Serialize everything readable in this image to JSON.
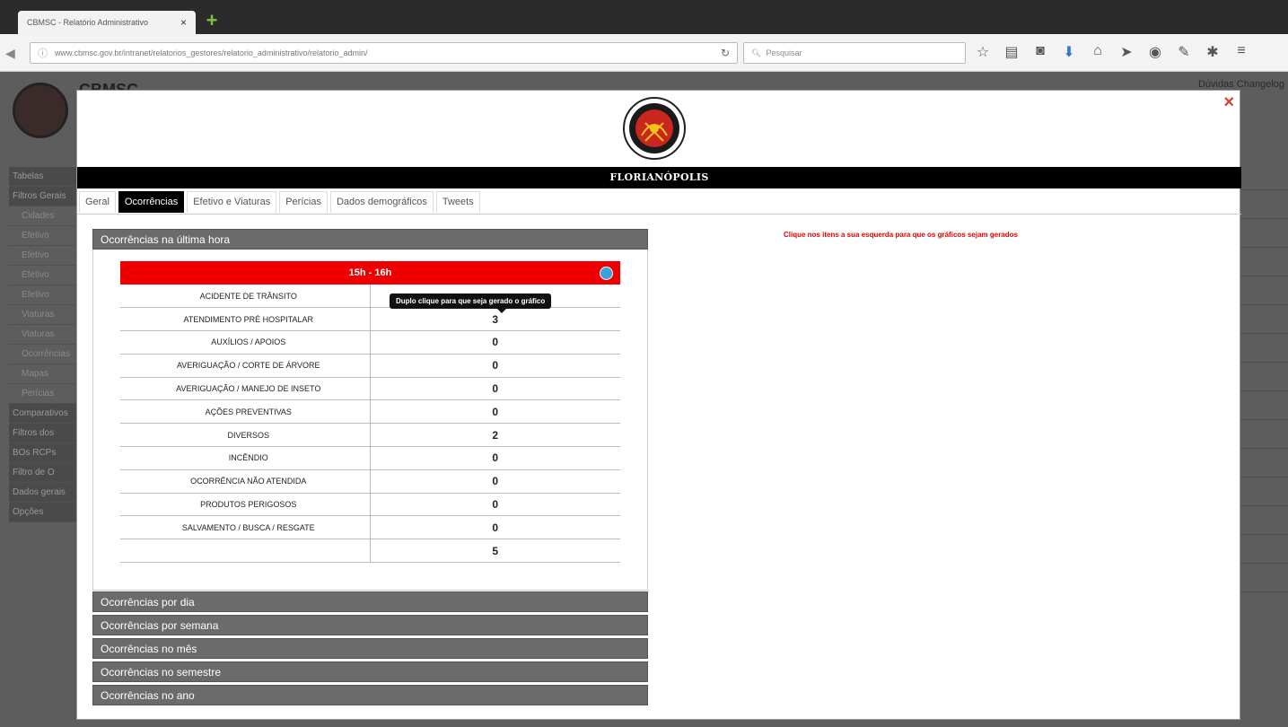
{
  "browser": {
    "tab_title": "CBMSC - Relatório Administrativo",
    "tab_close": "×",
    "new_tab": "+",
    "url": "www.cbmsc.gov.br/intranet/relatorios_gestores/relatorio_administrativo/relatorio_admin/",
    "search_placeholder": "Pesquisar",
    "nav_icons": [
      "star-icon",
      "reading-list-icon",
      "pocket-icon",
      "download-icon",
      "home-icon",
      "send-icon",
      "chat-icon",
      "tools-icon",
      "addon-icon",
      "menu-icon"
    ]
  },
  "background_page": {
    "title": "CBMSC",
    "top_right": "Dúvidas  Changelog",
    "sidebar": [
      {
        "label": "Tabelas",
        "type": "hdr"
      },
      {
        "label": "Filtros Gerais",
        "type": "hdr"
      },
      {
        "label": "Cidades",
        "type": "it"
      },
      {
        "label": "Efetivo",
        "type": "it"
      },
      {
        "label": "Efetivo",
        "type": "it"
      },
      {
        "label": "Efetivo",
        "type": "it"
      },
      {
        "label": "Efetivo",
        "type": "it"
      },
      {
        "label": "Viaturas",
        "type": "it"
      },
      {
        "label": "Viaturas",
        "type": "it"
      },
      {
        "label": "Ocorrências",
        "type": "it"
      },
      {
        "label": "Mapas",
        "type": "it"
      },
      {
        "label": "Perícias",
        "type": "it"
      },
      {
        "label": "Comparativos",
        "type": "hdr"
      },
      {
        "label": "Filtros dos",
        "type": "hdr"
      },
      {
        "label": "BOs RCPs",
        "type": "hdr"
      },
      {
        "label": "Filtro de O",
        "type": "hdr"
      },
      {
        "label": "Dados gerais",
        "type": "hdr"
      },
      {
        "label": "Opções",
        "type": "hdr"
      }
    ]
  },
  "modal": {
    "close": "×",
    "city": "FLORIANÓPOLIS",
    "tabs": [
      {
        "label": "Geral",
        "active": false
      },
      {
        "label": "Ocorrências",
        "active": true
      },
      {
        "label": "Efetivo e Viaturas",
        "active": false
      },
      {
        "label": "Perícias",
        "active": false
      },
      {
        "label": "Dados demográficos",
        "active": false
      },
      {
        "label": "Tweets",
        "active": false
      }
    ],
    "hint": "Clique nos itens a sua esquerda para que os gráficos sejam gerados",
    "panel_open": "Ocorrências na última hora",
    "table": {
      "header": "15h - 16h",
      "tooltip": "Duplo clique para que seja gerado o gráfico",
      "rows": [
        {
          "name": "ACIDENTE DE TRÂNSITO",
          "value": ""
        },
        {
          "name": "ATENDIMENTO PRÉ HOSPITALAR",
          "value": "3"
        },
        {
          "name": "AUXÍLIOS / APOIOS",
          "value": "0"
        },
        {
          "name": "AVERIGUAÇÃO / CORTE DE ÁRVORE",
          "value": "0"
        },
        {
          "name": "AVERIGUAÇÃO / MANEJO DE INSETO",
          "value": "0"
        },
        {
          "name": "AÇÕES PREVENTIVAS",
          "value": "0"
        },
        {
          "name": "DIVERSOS",
          "value": "2"
        },
        {
          "name": "INCÊNDIO",
          "value": "0"
        },
        {
          "name": "OCORRÊNCIA NÃO ATENDIDA",
          "value": "0"
        },
        {
          "name": "PRODUTOS PERIGOSOS",
          "value": "0"
        },
        {
          "name": "SALVAMENTO / BUSCA / RESGATE",
          "value": "0"
        },
        {
          "name": "",
          "value": "5"
        }
      ]
    },
    "collapsed_panels": [
      "Ocorrências por dia",
      "Ocorrências por semana",
      "Ocorrências no mês",
      "Ocorrências no semestre",
      "Ocorrências no ano"
    ]
  }
}
